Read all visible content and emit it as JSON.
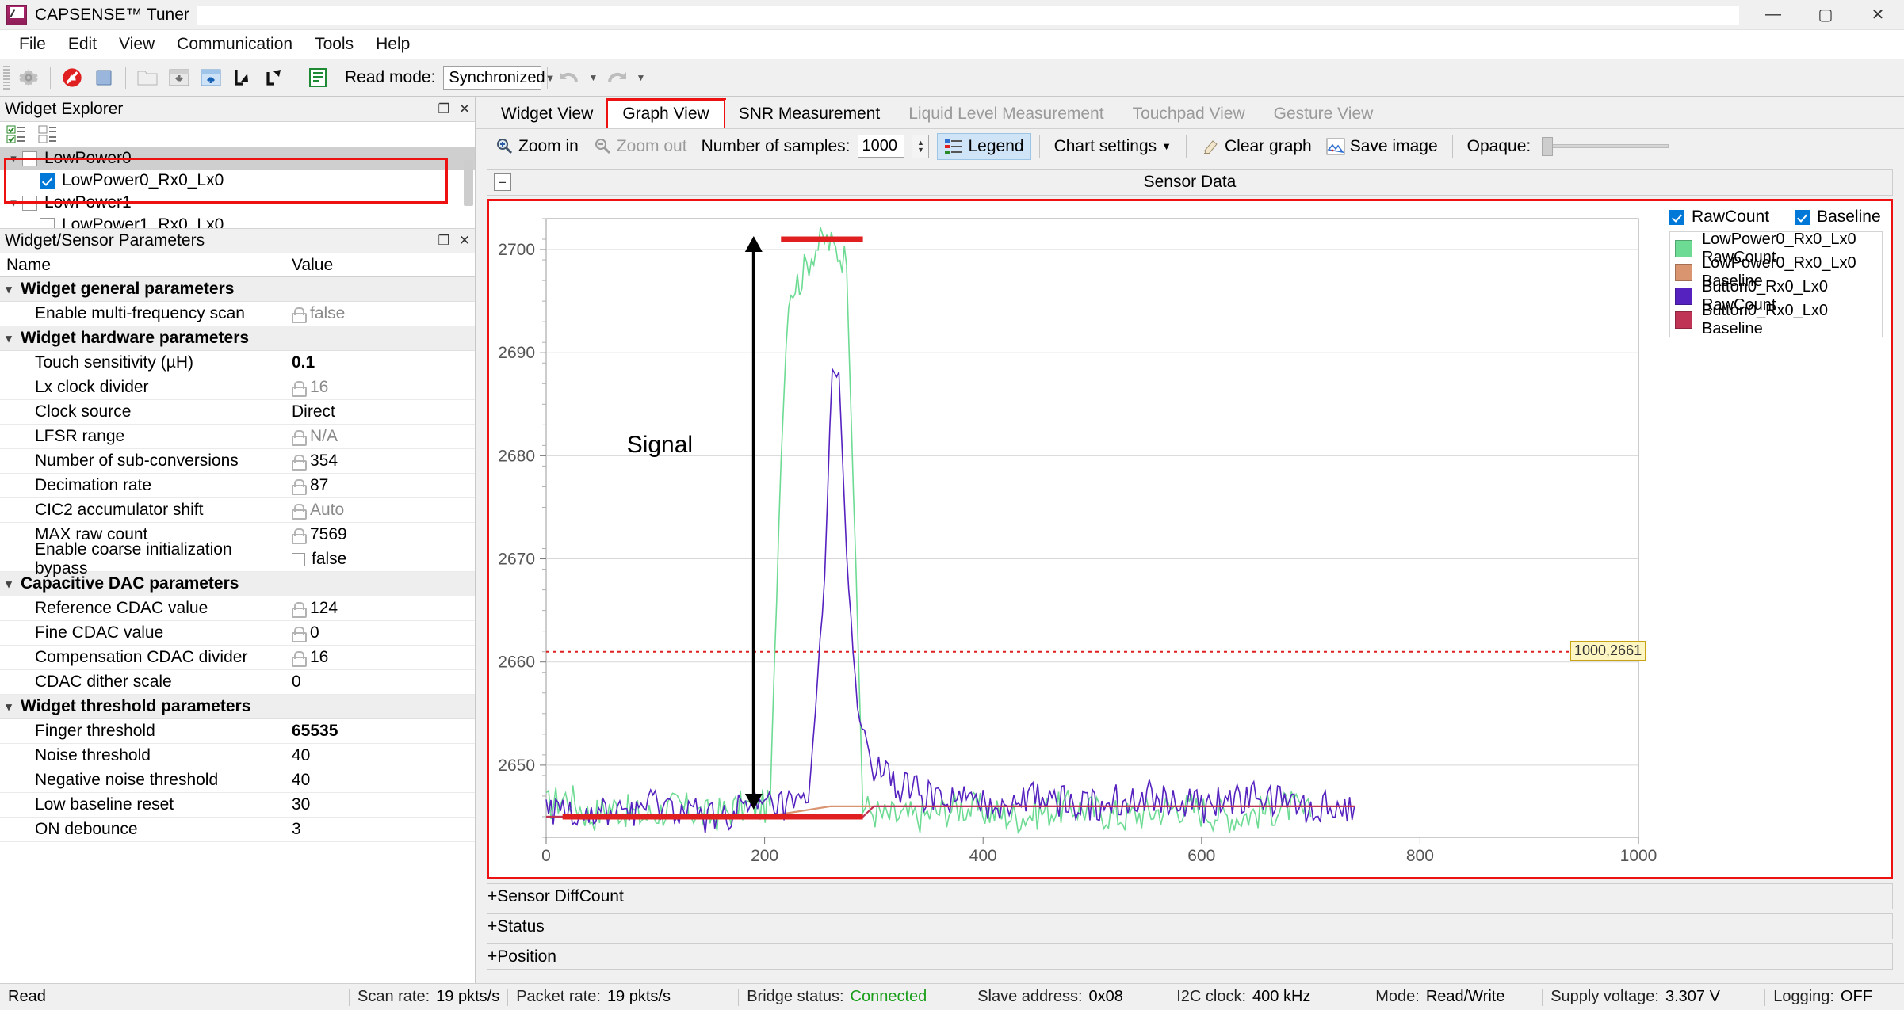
{
  "window": {
    "title": "CAPSENSE™ Tuner",
    "minimize": "—",
    "maximize": "▢",
    "close": "✕"
  },
  "menu": [
    "File",
    "Edit",
    "View",
    "Communication",
    "Tools",
    "Help"
  ],
  "toolbar": {
    "read_mode_label": "Read mode:",
    "read_mode_value": "Synchronized",
    "icons": [
      "gear-icon",
      "stop-scan-icon",
      "stop-icon",
      "open-file-icon",
      "apply-to-device-icon",
      "apply-to-project-icon",
      "import-icon",
      "export-icon",
      "log-icon"
    ],
    "undo_label": "Undo",
    "redo_label": "Redo"
  },
  "widget_explorer": {
    "title": "Widget Explorer",
    "tools": [
      "check-all-icon",
      "uncheck-all-icon"
    ],
    "tree": [
      {
        "label": "LowPower0",
        "checked": false,
        "level": 0,
        "expanded": true,
        "selected": true
      },
      {
        "label": "LowPower0_Rx0_Lx0",
        "checked": true,
        "level": 1,
        "expanded": false,
        "selected": false
      },
      {
        "label": "LowPower1",
        "checked": false,
        "level": 0,
        "expanded": true,
        "selected": false
      },
      {
        "label": "LowPower1_Rx0_Lx0",
        "checked": false,
        "level": 1,
        "expanded": false,
        "selected": false
      }
    ]
  },
  "parameters": {
    "title": "Widget/Sensor Parameters",
    "columns": [
      "Name",
      "Value"
    ],
    "rows": [
      {
        "name": "Widget general parameters",
        "value": "",
        "group": true
      },
      {
        "name": "Enable multi-frequency scan",
        "value": "false",
        "locked": true,
        "dim": true
      },
      {
        "name": "Widget hardware parameters",
        "value": "",
        "group": true
      },
      {
        "name": "Touch sensitivity (µH)",
        "value": "0.1",
        "bold": true
      },
      {
        "name": "Lx clock divider",
        "value": "16",
        "locked": true,
        "dim": true
      },
      {
        "name": "Clock source",
        "value": "Direct"
      },
      {
        "name": "LFSR range",
        "value": "N/A",
        "locked": true,
        "dim": true
      },
      {
        "name": "Number of sub-conversions",
        "value": "354",
        "locked": true
      },
      {
        "name": "Decimation rate",
        "value": "87",
        "locked": true
      },
      {
        "name": "CIC2 accumulator shift",
        "value": "Auto",
        "locked": true,
        "dim": true
      },
      {
        "name": "MAX raw count",
        "value": "7569",
        "locked": true
      },
      {
        "name": "Enable coarse initialization bypass",
        "value": "false",
        "checkbox": true
      },
      {
        "name": "Capacitive DAC parameters",
        "value": "",
        "group": true
      },
      {
        "name": "Reference CDAC value",
        "value": "124",
        "locked": true
      },
      {
        "name": "Fine CDAC value",
        "value": "0",
        "locked": true
      },
      {
        "name": "Compensation CDAC divider",
        "value": "16",
        "locked": true
      },
      {
        "name": "CDAC dither scale",
        "value": "0"
      },
      {
        "name": "Widget threshold parameters",
        "value": "",
        "group": true
      },
      {
        "name": "Finger threshold",
        "value": "65535",
        "bold": true
      },
      {
        "name": "Noise threshold",
        "value": "40"
      },
      {
        "name": "Negative noise threshold",
        "value": "40"
      },
      {
        "name": "Low baseline reset",
        "value": "30"
      },
      {
        "name": "ON debounce",
        "value": "3"
      }
    ]
  },
  "tabs": [
    {
      "label": "Widget View",
      "active": false,
      "disabled": false
    },
    {
      "label": "Graph View",
      "active": true,
      "disabled": false,
      "highlighted": true
    },
    {
      "label": "SNR Measurement",
      "active": false,
      "disabled": false
    },
    {
      "label": "Liquid Level Measurement",
      "active": false,
      "disabled": true
    },
    {
      "label": "Touchpad View",
      "active": false,
      "disabled": true
    },
    {
      "label": "Gesture View",
      "active": false,
      "disabled": true
    }
  ],
  "graph_toolbar": {
    "zoom_in": "Zoom in",
    "zoom_out": "Zoom out",
    "samples_label": "Number of samples:",
    "samples_value": "1000",
    "legend": "Legend",
    "chart_settings": "Chart settings",
    "clear_graph": "Clear graph",
    "save_image": "Save image",
    "opaque_label": "Opaque:"
  },
  "sections": {
    "sensor_data": {
      "title": "Sensor Data",
      "expander": "−"
    },
    "sensor_diffcount": {
      "title": "Sensor DiffCount",
      "expander": "+"
    },
    "status": {
      "title": "Status",
      "expander": "+"
    },
    "position": {
      "title": "Position",
      "expander": "+"
    }
  },
  "legend": {
    "rawcount_toggle": "RawCount",
    "baseline_toggle": "Baseline",
    "series": [
      {
        "label": "LowPower0_Rx0_Lx0 RawCount",
        "color": "#6ddb93"
      },
      {
        "label": "LowPower0_Rx0_Lx0 Baseline",
        "color": "#d99470"
      },
      {
        "label": "Button0_Rx0_Lx0 RawCount",
        "color": "#5522c0"
      },
      {
        "label": "Button0_Rx0_Lx0 Baseline",
        "color": "#bf3355"
      }
    ]
  },
  "chart_data": {
    "type": "line",
    "title": "Sensor Data",
    "xlabel": "",
    "ylabel": "",
    "xlim": [
      0,
      1000
    ],
    "ylim": [
      2643,
      2703
    ],
    "xticks": [
      0,
      200,
      400,
      600,
      800,
      1000
    ],
    "yticks": [
      2650,
      2660,
      2670,
      2680,
      2690,
      2700
    ],
    "grid": true,
    "legend_position": "right",
    "annotations": [
      {
        "text": "Signal",
        "type": "label",
        "x": 150,
        "y": 2680
      },
      {
        "text": "1000,2661",
        "type": "tooltip",
        "x": 1000,
        "y": 2661
      },
      {
        "text": "",
        "type": "double-arrow",
        "x": 190,
        "y_from": 2646,
        "y_to": 2701
      }
    ],
    "threshold_line": {
      "value": 2661,
      "color": "#e02020",
      "style": "dotted"
    },
    "series": [
      {
        "name": "LowPower0_Rx0_Lx0 RawCount",
        "color": "#6ddb93",
        "points": [
          [
            0,
            2646
          ],
          [
            20,
            2647
          ],
          [
            40,
            2645
          ],
          [
            60,
            2646
          ],
          [
            90,
            2645
          ],
          [
            120,
            2646
          ],
          [
            150,
            2645
          ],
          [
            180,
            2646
          ],
          [
            205,
            2646
          ],
          [
            215,
            2680
          ],
          [
            222,
            2696
          ],
          [
            232,
            2697
          ],
          [
            245,
            2700
          ],
          [
            255,
            2701
          ],
          [
            265,
            2700
          ],
          [
            275,
            2699
          ],
          [
            290,
            2646
          ],
          [
            310,
            2645
          ],
          [
            340,
            2645
          ],
          [
            380,
            2646
          ],
          [
            430,
            2645
          ],
          [
            480,
            2646
          ],
          [
            530,
            2645
          ],
          [
            580,
            2646
          ],
          [
            630,
            2645
          ],
          [
            680,
            2646
          ],
          [
            700,
            2645
          ]
        ]
      },
      {
        "name": "LowPower0_Rx0_Lx0 Baseline",
        "color": "#d99470",
        "points": [
          [
            0,
            2645
          ],
          [
            200,
            2645
          ],
          [
            260,
            2646
          ],
          [
            400,
            2646
          ],
          [
            700,
            2646
          ]
        ]
      },
      {
        "name": "Button0_Rx0_Lx0 RawCount",
        "color": "#5522c0",
        "points": [
          [
            0,
            2646
          ],
          [
            50,
            2645
          ],
          [
            100,
            2646
          ],
          [
            150,
            2645
          ],
          [
            200,
            2646
          ],
          [
            240,
            2646
          ],
          [
            255,
            2668
          ],
          [
            262,
            2690
          ],
          [
            268,
            2688
          ],
          [
            275,
            2670
          ],
          [
            285,
            2655
          ],
          [
            300,
            2650
          ],
          [
            320,
            2648
          ],
          [
            350,
            2647
          ],
          [
            400,
            2646
          ],
          [
            450,
            2647
          ],
          [
            500,
            2646
          ],
          [
            550,
            2647
          ],
          [
            600,
            2646
          ],
          [
            650,
            2647
          ],
          [
            700,
            2646
          ],
          [
            740,
            2646
          ]
        ]
      },
      {
        "name": "Button0_Rx0_Lx0 Baseline",
        "color": "#bf3355",
        "points": [
          [
            0,
            2645
          ],
          [
            190,
            2645
          ],
          [
            200,
            2645
          ],
          [
            290,
            2645
          ],
          [
            300,
            2646
          ],
          [
            430,
            2646
          ],
          [
            440,
            2646
          ],
          [
            740,
            2646
          ]
        ]
      }
    ],
    "highlight_bars": [
      {
        "color": "#e02020",
        "x_from": 215,
        "x_to": 290,
        "y": 2701
      },
      {
        "color": "#e02020",
        "x_from": 15,
        "x_to": 205,
        "y": 2645
      },
      {
        "color": "#e02020",
        "x_from": 205,
        "x_to": 290,
        "y": 2645
      }
    ]
  },
  "statusbar": {
    "state": "Read",
    "scan_rate_label": "Scan rate:",
    "scan_rate": "19 pkts/s",
    "packet_rate_label": "Packet rate:",
    "packet_rate": "19 pkts/s",
    "bridge_label": "Bridge status:",
    "bridge": "Connected",
    "slave_label": "Slave address:",
    "slave": "0x08",
    "i2c_label": "I2C clock:",
    "i2c": "400 kHz",
    "mode_label": "Mode:",
    "mode": "Read/Write",
    "supply_label": "Supply voltage:",
    "supply": "3.307 V",
    "logging_label": "Logging:",
    "logging": "OFF"
  }
}
